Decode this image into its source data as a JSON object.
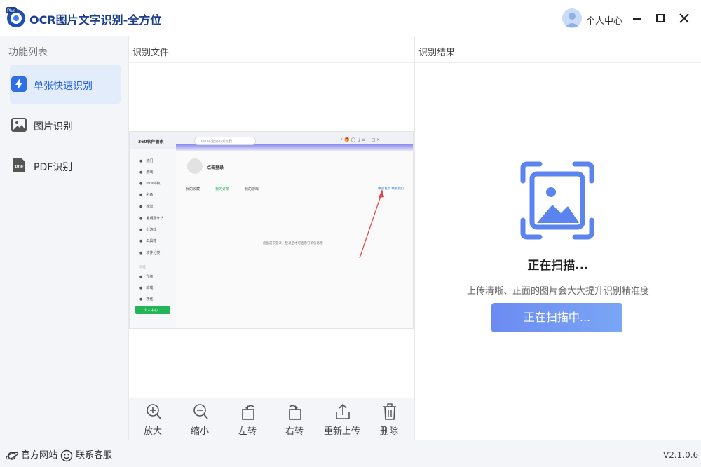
{
  "app": {
    "title": "OCR图片文字识别-全方位",
    "logo_badge": "Plus"
  },
  "header": {
    "user_label": "个人中心"
  },
  "sidebar": {
    "title": "功能列表",
    "items": [
      {
        "label": "单张快速识别",
        "active": true
      },
      {
        "label": "图片识别",
        "active": false
      },
      {
        "label": "PDF识别",
        "active": false
      }
    ]
  },
  "file_panel": {
    "title": "识别文件"
  },
  "result_panel": {
    "title": "识别结果",
    "status_title": "正在扫描...",
    "hint": "上传清晰、正面的图片会大大提升识别精准度",
    "button_label": "正在扫描中..."
  },
  "toolbar": {
    "zoom_in": "放大",
    "zoom_out": "缩小",
    "rotate_left": "左转",
    "rotate_right": "右转",
    "reupload": "重新上传",
    "delete": "删除"
  },
  "preview": {
    "logo": "360软件管家",
    "search": "TabAi-全能AI浏览器",
    "menu": [
      "热门",
      "游戏",
      "Plus特权",
      "必备",
      "榜单",
      "暑期嘉年华",
      "小游戏",
      "工具箱",
      "软件分类"
    ],
    "menu_section": "功能",
    "menu2": [
      "升级",
      "卸载",
      "净化"
    ],
    "user_center": "个人中心",
    "login": "点击登录",
    "tabs": [
      "我的收藏",
      "我的订单",
      "我的游戏"
    ],
    "links": "申请发票  联系我们",
    "message": "您当前未登录，登录后才可查看订单信息哦"
  },
  "footer": {
    "website": "官方网站",
    "support": "联系客服",
    "version": "V2.1.0.6"
  },
  "colors": {
    "accent": "#1d5fe0",
    "scan_blue": "#5b84ee",
    "button_gradient_start": "#6c8bf2",
    "button_gradient_end": "#7aa6f5"
  }
}
